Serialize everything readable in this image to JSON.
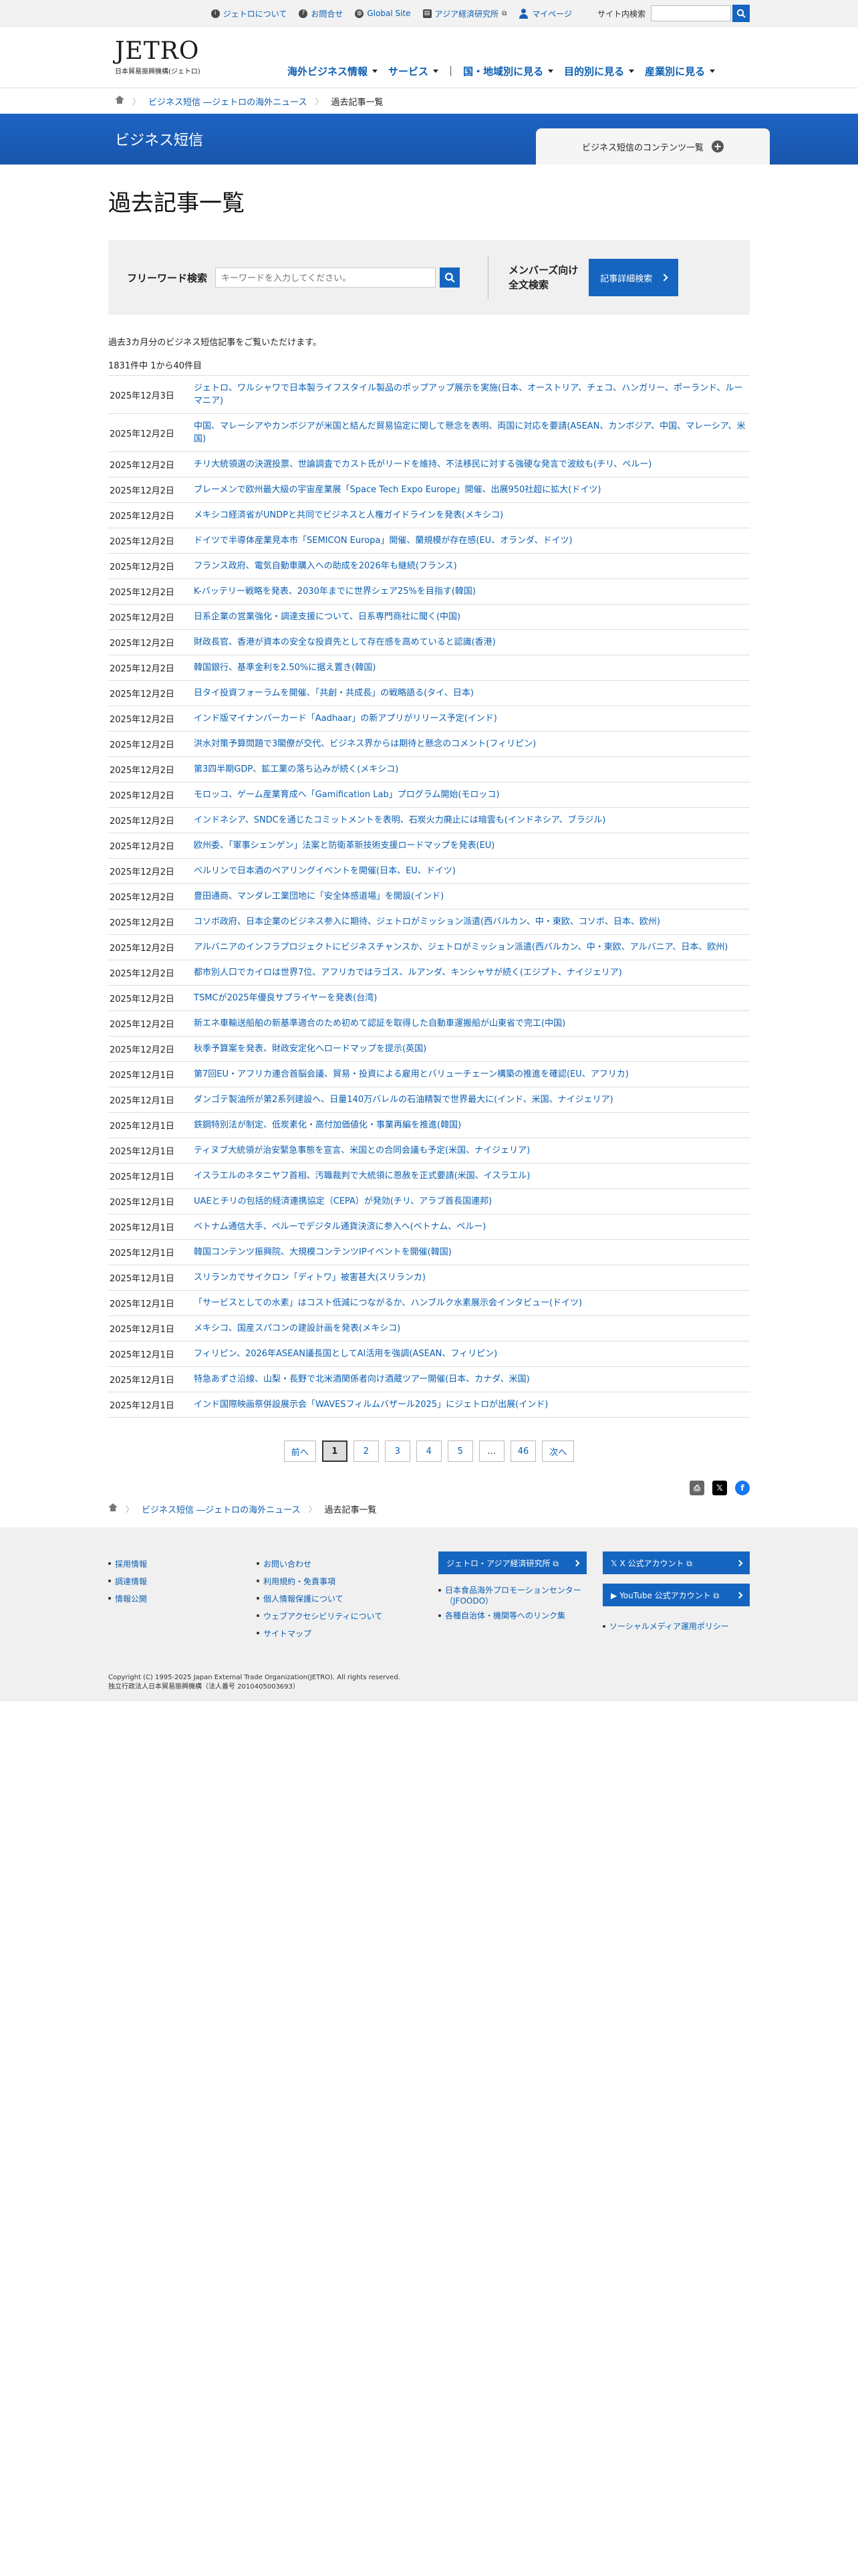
{
  "utility": {
    "about": "ジェトロについて",
    "contact": "お問合せ",
    "global": "Global Site",
    "ide": "アジア経済研究所",
    "mypage": "マイページ",
    "search_label": "サイト内検索"
  },
  "header": {
    "logo": "JETRO",
    "logo_sub": "日本貿易振興機構(ジェトロ)",
    "nav": [
      "海外ビジネス情報",
      "サービス",
      "国・地域別に見る",
      "目的別に見る",
      "産業別に見る"
    ]
  },
  "breadcrumb": [
    "ビジネス短信 ―ジェトロの海外ニュース",
    "過去記事一覧"
  ],
  "banner": {
    "title": "ビジネス短信",
    "contents_tab": "ビジネス短信のコンテンツ一覧"
  },
  "page_title": "過去記事一覧",
  "search": {
    "label": "フリーワード検索",
    "placeholder": "キーワードを入力してください。",
    "member_line1": "メンバーズ向け",
    "member_line2": "全文検索",
    "detail_button": "記事詳細検索"
  },
  "note": "過去3カ月分のビジネス短信記事をご覧いただけます。",
  "count": "1831件中 1から40件目",
  "articles": [
    {
      "date": "2025年12月3日",
      "title": "ジェトロ、ワルシャワで日本製ライフスタイル製品のポップアップ展示を実施(日本、オーストリア、チェコ、ハンガリー、ポーランド、ルーマニア)"
    },
    {
      "date": "2025年12月2日",
      "title": "中国、マレーシアやカンボジアが米国と結んだ貿易協定に関して懸念を表明、両国に対応を要請(ASEAN、カンボジア、中国、マレーシア、米国)"
    },
    {
      "date": "2025年12月2日",
      "title": "チリ大統領選の決選投票、世論調査でカスト氏がリードを維持、不法移民に対する強硬な発言で波紋も(チリ、ペルー)"
    },
    {
      "date": "2025年12月2日",
      "title": "ブレーメンで欧州最大級の宇宙産業展「Space Tech Expo Europe」開催、出展950社超に拡大(ドイツ)"
    },
    {
      "date": "2025年12月2日",
      "title": "メキシコ経済省がUNDPと共同でビジネスと人権ガイドラインを発表(メキシコ)"
    },
    {
      "date": "2025年12月2日",
      "title": "ドイツで半導体産業見本市「SEMICON Europa」開催、蘭規模が存在感(EU、オランダ、ドイツ)"
    },
    {
      "date": "2025年12月2日",
      "title": "フランス政府、電気自動車購入への助成を2026年も継続(フランス)"
    },
    {
      "date": "2025年12月2日",
      "title": "K-バッテリー戦略を発表、2030年までに世界シェア25%を目指す(韓国)"
    },
    {
      "date": "2025年12月2日",
      "title": "日系企業の営業強化・調達支援について、日系専門商社に聞く(中国)"
    },
    {
      "date": "2025年12月2日",
      "title": "財政長官、香港が資本の安全な投資先として存在感を高めていると認識(香港)"
    },
    {
      "date": "2025年12月2日",
      "title": "韓国銀行、基準金利を2.50%に据え置き(韓国)"
    },
    {
      "date": "2025年12月2日",
      "title": "日タイ投資フォーラムを開催、「共創・共成長」の戦略語る(タイ、日本)"
    },
    {
      "date": "2025年12月2日",
      "title": "インド版マイナンバーカード「Aadhaar」の新アプリがリリース予定(インド)"
    },
    {
      "date": "2025年12月2日",
      "title": "洪水対策予算問題で3閣僚が交代、ビジネス界からは期待と懸念のコメント(フィリピン)"
    },
    {
      "date": "2025年12月2日",
      "title": "第3四半期GDP、鉱工業の落ち込みが続く(メキシコ)"
    },
    {
      "date": "2025年12月2日",
      "title": "モロッコ、ゲーム産業育成へ「Gamification Lab」プログラム開始(モロッコ)"
    },
    {
      "date": "2025年12月2日",
      "title": "インドネシア、SNDCを通じたコミットメントを表明、石炭火力廃止には暗雲も(インドネシア、ブラジル)"
    },
    {
      "date": "2025年12月2日",
      "title": "欧州委、「軍事シェンゲン」法案と防衛革新技術支援ロードマップを発表(EU)"
    },
    {
      "date": "2025年12月2日",
      "title": "ベルリンで日本酒のペアリングイベントを開催(日本、EU、ドイツ)"
    },
    {
      "date": "2025年12月2日",
      "title": "豊田通商、マンダレ工業団地に「安全体感道場」を開設(インド)"
    },
    {
      "date": "2025年12月2日",
      "title": "コソボ政府、日本企業のビジネス参入に期待、ジェトロがミッション派遣(西バルカン、中・東欧、コソボ、日本、欧州)"
    },
    {
      "date": "2025年12月2日",
      "title": "アルバニアのインフラプロジェクトにビジネスチャンスか、ジェトロがミッション派遣(西バルカン、中・東欧、アルバニア、日本、欧州)"
    },
    {
      "date": "2025年12月2日",
      "title": "都市別人口でカイロは世界7位、アフリカではラゴス、ルアンダ、キンシャサが続く(エジプト、ナイジェリア)"
    },
    {
      "date": "2025年12月2日",
      "title": "TSMCが2025年優良サプライヤーを発表(台湾)"
    },
    {
      "date": "2025年12月2日",
      "title": "新エネ車輸送船舶の新基準適合のため初めて認証を取得した自動車運搬船が山東省で完工(中国)"
    },
    {
      "date": "2025年12月2日",
      "title": "秋季予算案を発表、財政安定化へロードマップを提示(英国)"
    },
    {
      "date": "2025年12月1日",
      "title": "第7回EU・アフリカ連合首脳会議、貿易・投資による雇用とバリューチェーン構築の推進を確認(EU、アフリカ)"
    },
    {
      "date": "2025年12月1日",
      "title": "ダンゴテ製油所が第2系列建設へ、日量140万バレルの石油精製で世界最大に(インド、米国、ナイジェリア)"
    },
    {
      "date": "2025年12月1日",
      "title": "鉄鋼特別法が制定、低炭素化・高付加価値化・事業再編を推進(韓国)"
    },
    {
      "date": "2025年12月1日",
      "title": "ティヌブ大統領が治安緊急事態を宣言、米国との合同会議も予定(米国、ナイジェリア)"
    },
    {
      "date": "2025年12月1日",
      "title": "イスラエルのネタニヤフ首相、汚職裁判で大統領に恩赦を正式要請(米国、イスラエル)"
    },
    {
      "date": "2025年12月1日",
      "title": "UAEとチリの包括的経済連携協定（CEPA）が発効(チリ、アラブ首長国連邦)"
    },
    {
      "date": "2025年12月1日",
      "title": "ベトナム通信大手、ペルーでデジタル通貨決済に参入へ(ベトナム、ペルー)"
    },
    {
      "date": "2025年12月1日",
      "title": "韓国コンテンツ振興院、大規模コンテンツIPイベントを開催(韓国)"
    },
    {
      "date": "2025年12月1日",
      "title": "スリランカでサイクロン「ディトワ」被害甚大(スリランカ)"
    },
    {
      "date": "2025年12月1日",
      "title": "「サービスとしての水素」はコスト低減につながるか、ハンブルク水素展示会インタビュー(ドイツ)"
    },
    {
      "date": "2025年12月1日",
      "title": "メキシコ、国産スパコンの建設計画を発表(メキシコ)"
    },
    {
      "date": "2025年12月1日",
      "title": "フィリピン、2026年ASEAN議長国としてAI活用を強調(ASEAN、フィリピン)"
    },
    {
      "date": "2025年12月1日",
      "title": "特急あずさ沿線、山梨・長野で北米酒関係者向け酒蔵ツアー開催(日本、カナダ、米国)"
    },
    {
      "date": "2025年12月1日",
      "title": "インド国際映画祭併設展示会「WAVESフィルムバザール2025」にジェトロが出展(インド)"
    }
  ],
  "pager": {
    "prev": "前へ",
    "pages": [
      "1",
      "2",
      "3",
      "4",
      "5"
    ],
    "dots": "…",
    "last": "46",
    "next": "次へ"
  },
  "footer": {
    "col1": [
      "採用情報",
      "調達情報",
      "情報公開"
    ],
    "col2": [
      "お問い合わせ",
      "利用規約・免責事項",
      "個人情報保護について",
      "ウェブアクセシビリティについて",
      "サイトマップ"
    ],
    "ide_button": "ジェトロ・アジア経済研究所",
    "col3_links": [
      "日本食品海外プロモーションセンター（JFOODO）",
      "各種自治体・機関等へのリンク集"
    ],
    "x_button": "X 公式アカウント",
    "youtube_button": "YouTube 公式アカウント",
    "col4_links": [
      "ソーシャルメディア運用ポリシー"
    ],
    "copyright": "Copyright (C) 1995-2025 Japan External Trade Organization(JETRO). All rights reserved.",
    "corp": "独立行政法人日本貿易振興機構（法人番号 2010405003693）"
  }
}
